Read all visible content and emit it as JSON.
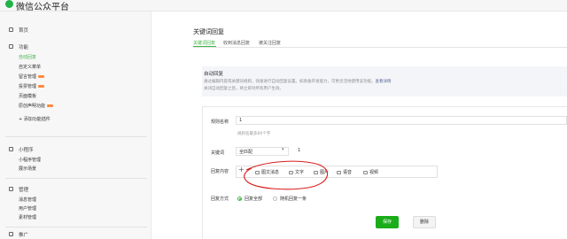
{
  "app": {
    "title": "微信公众平台"
  },
  "sidebar": {
    "home": "首页",
    "sections": [
      {
        "title": "功能",
        "items": [
          {
            "label": "自动回复",
            "active": true,
            "badge": false
          },
          {
            "label": "自定义菜单",
            "active": false,
            "badge": false
          },
          {
            "label": "留言管理",
            "active": false,
            "badge": true
          },
          {
            "label": "投票管理",
            "active": false,
            "badge": true
          },
          {
            "label": "页面模板",
            "active": false,
            "badge": false
          },
          {
            "label": "原创声明功能",
            "active": false,
            "badge": true
          }
        ],
        "add": "+ 添加功能插件"
      },
      {
        "title": "小程序",
        "items": [
          {
            "label": "小程序管理"
          },
          {
            "label": "展示场景"
          }
        ]
      },
      {
        "title": "管理",
        "items": [
          {
            "label": "消息管理"
          },
          {
            "label": "用户管理"
          },
          {
            "label": "素材管理"
          }
        ]
      },
      {
        "title": "推广",
        "items": []
      }
    ]
  },
  "main": {
    "title": "关键词回复",
    "tabs": [
      "关键词回复",
      "收到消息回复",
      "被关注回复"
    ],
    "info": {
      "title": "自动回复",
      "line1": "通过编辑内容或关键词规则，快速进行自动回复设置。如具备开发能力，可更灵活地使用该功能。",
      "link": "查看详情",
      "line2": "关闭自动回复之后，将立即对所有用户生效。"
    },
    "form": {
      "rule_name_label": "规则名称",
      "rule_name_value": "1",
      "rule_name_hint": "规则名最多60个字",
      "keyword_label": "关键词",
      "match_mode": "全匹配",
      "keyword_value": "1",
      "reply_label": "回复内容",
      "reply_tools": [
        "图文消息",
        "文字",
        "图片",
        "语音",
        "视频"
      ],
      "reply_mode_label": "回复方式",
      "reply_modes": [
        "回复全部",
        "随机回复一条"
      ]
    },
    "actions": {
      "save": "保存",
      "delete": "删除"
    }
  },
  "colors": {
    "accent": "#44b549",
    "save": "#1aad19",
    "annotation": "#d91e1e"
  }
}
